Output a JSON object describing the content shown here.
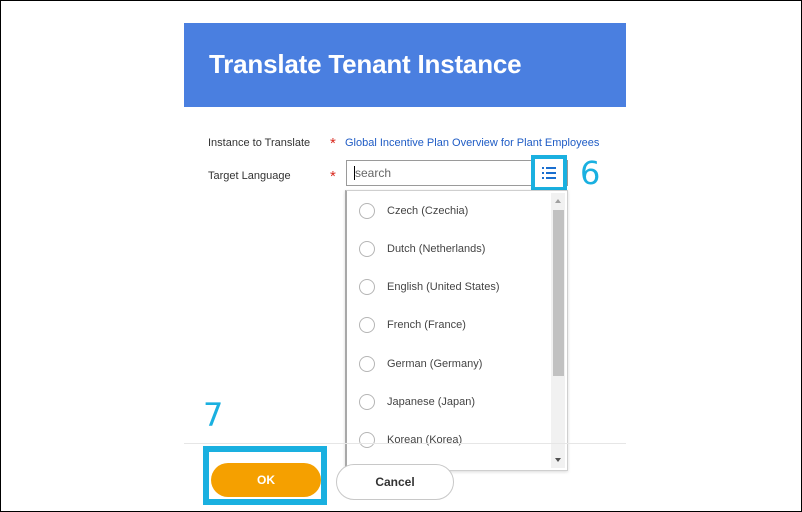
{
  "dialog": {
    "title": "Translate Tenant Instance",
    "header_color": "#4a7fe0"
  },
  "form": {
    "instance_label": "Instance to Translate",
    "instance_value": "Global Incentive Plan Overview for Plant Employees",
    "target_label": "Target Language",
    "required_marker": "*",
    "search_placeholder": "search",
    "prompt_icon": "list-icon"
  },
  "dropdown": {
    "options": [
      {
        "label": "Czech (Czechia)"
      },
      {
        "label": "Dutch (Netherlands)"
      },
      {
        "label": "English (United States)"
      },
      {
        "label": "French (France)"
      },
      {
        "label": "German (Germany)"
      },
      {
        "label": "Japanese (Japan)"
      },
      {
        "label": "Korean (Korea)"
      }
    ]
  },
  "annotations": {
    "step_6": "6",
    "step_7": "7",
    "highlight_color": "#1ab0e0"
  },
  "buttons": {
    "ok_label": "OK",
    "cancel_label": "Cancel",
    "ok_color": "#f5a000"
  }
}
